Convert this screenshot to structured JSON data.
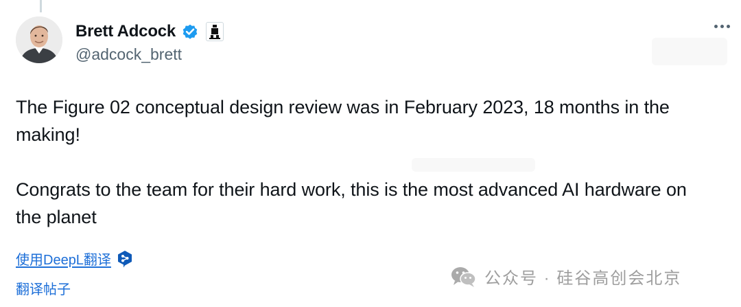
{
  "author": {
    "display_name": "Brett Adcock",
    "handle": "@adcock_brett",
    "verified_badge_color": "#1d9bf0"
  },
  "post": {
    "paragraphs": [
      "The Figure 02 conceptual design review was in February 2023, 18 months in the making!",
      "Congrats to the team for their hard work, this is the most advanced AI hardware on the planet"
    ]
  },
  "actions": {
    "translate_deepl_label": "使用DeepL翻译",
    "translate_post_label": "翻译帖子"
  },
  "watermark": {
    "text": "公众号 · 硅谷高创会北京",
    "icon": "wechat-icon"
  },
  "icons": {
    "verified": "verified-badge-icon",
    "affiliation": "figure-affiliation-icon",
    "more": "more-options-icon",
    "deepl": "deepl-icon"
  },
  "colors": {
    "text": "#0f1419",
    "secondary_text": "#536471",
    "link": "#1d6fd8",
    "verified": "#1d9bf0",
    "watermark": "#7a7a7a"
  }
}
